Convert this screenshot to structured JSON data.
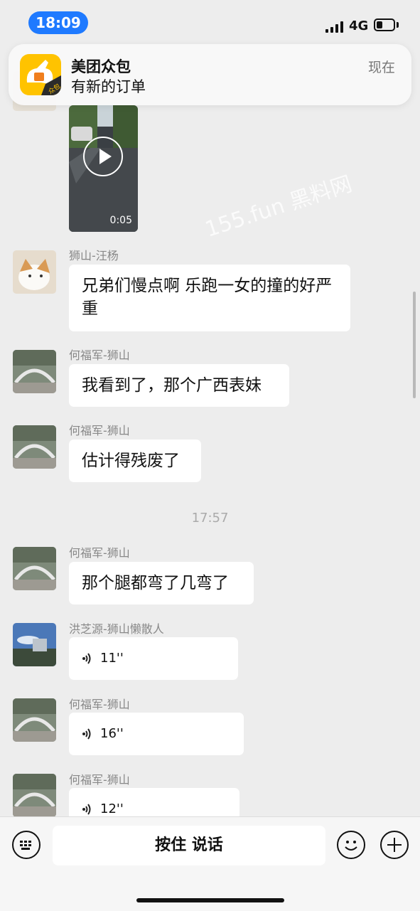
{
  "status_bar": {
    "time": "18:09",
    "network": "4G",
    "battery_level": 0.3
  },
  "notification": {
    "app_name": "美团众包",
    "message": "有新的订单",
    "time": "现在",
    "icon_badge": "众包"
  },
  "video": {
    "duration": "0:05"
  },
  "watermark": "155.fun 黑料网",
  "timestamp": "17:57",
  "messages": [
    {
      "sender": "狮山-汪杨",
      "text": "兄弟们慢点啊  乐跑一女的撞的好严重"
    },
    {
      "sender": "何福军-狮山",
      "text": "我看到了，那个广西表妹"
    },
    {
      "sender": "何福军-狮山",
      "text": "估计得残废了"
    },
    {
      "sender": "何福军-狮山",
      "text": "那个腿都弯了几弯了"
    },
    {
      "sender": "洪芝源-狮山懒散人",
      "voice_duration": "11''"
    },
    {
      "sender": "何福军-狮山",
      "voice_duration": "16''"
    },
    {
      "sender": "何福军-狮山",
      "voice_duration": "12''"
    }
  ],
  "input_bar": {
    "hold_to_talk": "按住 说话"
  },
  "icons": [
    "keyboard-icon",
    "emoji-icon",
    "plus-icon",
    "play-icon",
    "voice-wave-icon"
  ],
  "colors": {
    "background": "#ededed",
    "bubble": "#ffffff",
    "time_pill": "#1f7aff"
  }
}
